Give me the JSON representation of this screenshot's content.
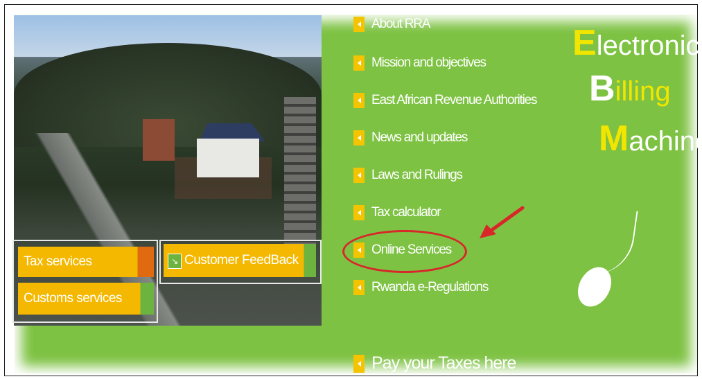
{
  "photo_buttons": {
    "tax_services": "Tax services",
    "customs_services": "Customs services",
    "customer_feedback": "Customer FeedBack"
  },
  "menu": {
    "items": [
      {
        "label": "About RRA"
      },
      {
        "label": "Mission and objectives"
      },
      {
        "label": "East African Revenue Authorities"
      },
      {
        "label": "News and updates"
      },
      {
        "label": "Laws and Rulings"
      },
      {
        "label": "Tax calculator"
      },
      {
        "label": "Online Services"
      },
      {
        "label": "Rwanda e-Regulations"
      }
    ],
    "pay_taxes": "Pay your Taxes here"
  },
  "ebm": {
    "line1_cap": "E",
    "line1_rest": "lectronic",
    "line2_cap": "B",
    "line2_rest": "illing",
    "line3_cap": "M",
    "line3_rest": "achine"
  },
  "colors": {
    "background_green": "#7dc242",
    "button_yellow": "#f4b800",
    "highlight_red": "#d8262b",
    "accent_yellow": "#f2e600"
  }
}
